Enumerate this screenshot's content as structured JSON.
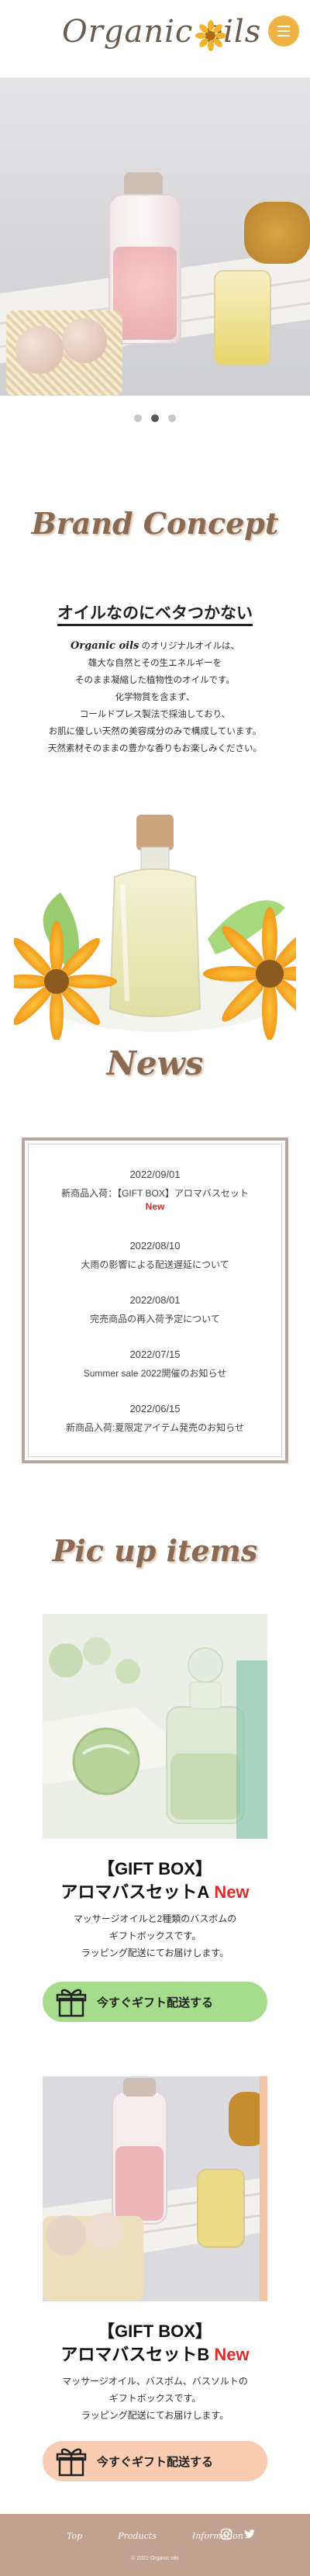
{
  "header": {
    "logo": "Organic oils",
    "menu_icon": "hamburger-icon"
  },
  "hero": {
    "carousel_dots": 3,
    "active_dot": 2
  },
  "brand_concept": {
    "title": "Brand Concept",
    "heading": "オイルなのにベタつかない",
    "brand": "Organic oils",
    "intro_rest": " のオリジナルオイルは、",
    "lines": [
      "雄大な自然とその生エネルギーを",
      "そのまま凝縮した植物性のオイルです。",
      "化学物質を含まず、",
      "コールドプレス製法で採油しており、",
      "お肌に優しい天然の美容成分のみで構成しています。",
      "天然素材そのままの豊かな香りもお楽しみください。"
    ]
  },
  "news": {
    "title": "News",
    "items": [
      {
        "date": "2022/09/01",
        "text": "新商品入荷：【GIFT BOX】アロマバスセット",
        "tag": "New"
      },
      {
        "date": "2022/08/10",
        "text": "大雨の影響による配送遅延について",
        "tag": ""
      },
      {
        "date": "2022/08/01",
        "text": "完売商品の再入荷予定について",
        "tag": ""
      },
      {
        "date": "2022/07/15",
        "text": "Summer sale 2022開催のお知らせ",
        "tag": ""
      },
      {
        "date": "2022/06/15",
        "text": "新商品入荷:夏限定アイテム発売のお知らせ",
        "tag": ""
      }
    ]
  },
  "pickup": {
    "title": "Pic up items",
    "items": [
      {
        "label_top": "【GIFT BOX】",
        "name": "アロマバスセットA",
        "badge": "New",
        "desc": [
          "マッサージオイルと2種類のバスボムの",
          "ギフトボックスです。",
          "ラッピング配送にてお届けします。"
        ],
        "button": "今すぐギフト配送する",
        "accent": "#a6dd8c"
      },
      {
        "label_top": "【GIFT BOX】",
        "name": "アロマバスセットB",
        "badge": "New",
        "desc": [
          "マッサージオイル、バスボム、バスソルトの",
          "ギフトボックスです。",
          "ラッピング配送にてお届けします。"
        ],
        "button": "今すぐギフト配送する",
        "accent": "#f9cdb1"
      }
    ]
  },
  "footer": {
    "nav": [
      "Top",
      "Products",
      "Information"
    ],
    "social_icons": [
      "instagram-icon",
      "twitter-icon"
    ],
    "copyright": "© 2022 Organic oils"
  },
  "colors": {
    "accent": "#f0b446",
    "title_brown": "#8a6a52",
    "new_red": "#e02b2b",
    "footer_bg": "#c2a18e"
  }
}
